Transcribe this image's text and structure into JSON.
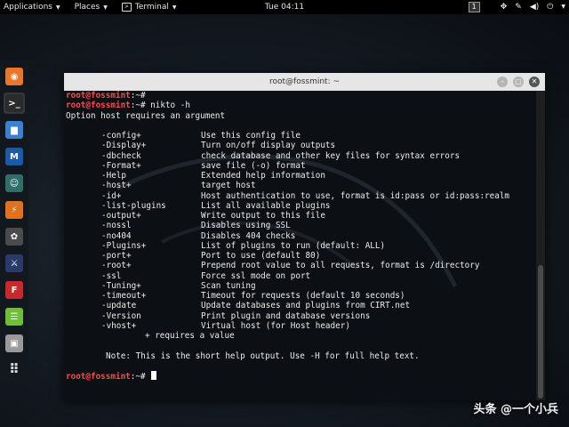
{
  "topbar": {
    "applications": "Applications",
    "places": "Places",
    "terminal": "Terminal",
    "clock": "Tue 04:11",
    "workspace": "1"
  },
  "dock": {
    "items": [
      {
        "name": "firefox-icon",
        "color": "#e8762c",
        "glyph": "◉"
      },
      {
        "name": "terminal-icon",
        "color": "#2b2b2b",
        "glyph": ">_"
      },
      {
        "name": "files-icon",
        "color": "#3d7fd1",
        "glyph": "▆"
      },
      {
        "name": "metasploit-icon",
        "color": "#1b5aa6",
        "glyph": "M"
      },
      {
        "name": "armitage-icon",
        "color": "#2f6f6a",
        "glyph": "☺"
      },
      {
        "name": "burpsuite-icon",
        "color": "#e0721f",
        "glyph": "⚡"
      },
      {
        "name": "maltego-icon",
        "color": "#4b4b4b",
        "glyph": "✿"
      },
      {
        "name": "beef-icon",
        "color": "#2a3b6b",
        "glyph": "⚔"
      },
      {
        "name": "faraday-icon",
        "color": "#c72a2a",
        "glyph": "F"
      },
      {
        "name": "leafpad-icon",
        "color": "#6dbf3a",
        "glyph": "☰"
      },
      {
        "name": "screenshot-icon",
        "color": "#9a9a9a",
        "glyph": "▣"
      },
      {
        "name": "app-grid-icon",
        "color": "transparent",
        "glyph": "⠿"
      }
    ]
  },
  "window": {
    "title": "root@fossmint: ~"
  },
  "terminal": {
    "prompt_user": "root@fossmint",
    "prompt_path": ":~#",
    "command": " nikto -h",
    "error": "Option host requires an argument",
    "options": [
      {
        "opt": "-config+",
        "desc": "Use this config file"
      },
      {
        "opt": "-Display+",
        "desc": "Turn on/off display outputs"
      },
      {
        "opt": "-dbcheck",
        "desc": "check database and other key files for syntax errors"
      },
      {
        "opt": "-Format+",
        "desc": "save file (-o) format"
      },
      {
        "opt": "-Help",
        "desc": "Extended help information"
      },
      {
        "opt": "-host+",
        "desc": "target host"
      },
      {
        "opt": "-id+",
        "desc": "Host authentication to use, format is id:pass or id:pass:realm"
      },
      {
        "opt": "-list-plugins",
        "desc": "List all available plugins"
      },
      {
        "opt": "-output+",
        "desc": "Write output to this file"
      },
      {
        "opt": "-nossl",
        "desc": "Disables using SSL"
      },
      {
        "opt": "-no404",
        "desc": "Disables 404 checks"
      },
      {
        "opt": "-Plugins+",
        "desc": "List of plugins to run (default: ALL)"
      },
      {
        "opt": "-port+",
        "desc": "Port to use (default 80)"
      },
      {
        "opt": "-root+",
        "desc": "Prepend root value to all requests, format is /directory"
      },
      {
        "opt": "-ssl",
        "desc": "Force ssl mode on port"
      },
      {
        "opt": "-Tuning+",
        "desc": "Scan tuning"
      },
      {
        "opt": "-timeout+",
        "desc": "Timeout for requests (default 10 seconds)"
      },
      {
        "opt": "-update",
        "desc": "Update databases and plugins from CIRT.net"
      },
      {
        "opt": "-Version",
        "desc": "Print plugin and database versions"
      },
      {
        "opt": "-vhost+",
        "desc": "Virtual host (for Host header)"
      }
    ],
    "requires_note": "+ requires a value",
    "help_note": "Note: This is the short help output. Use -H for full help text."
  },
  "watermark": "头条 @一个小兵"
}
